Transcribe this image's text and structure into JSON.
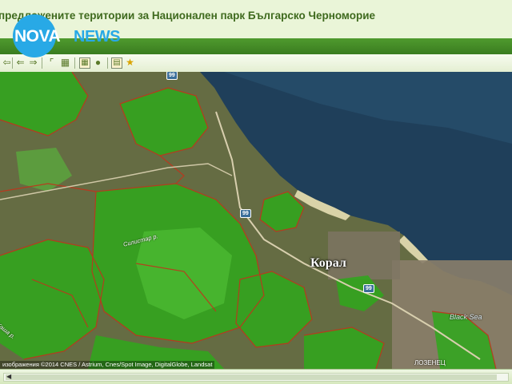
{
  "header": {
    "title": "предложените територии за Национален парк Българско Черноморие",
    "logo_nova": "NOVA",
    "logo_news": "NEWS",
    "brand_blue": "#28a9e6",
    "band_green": "#3a7d20"
  },
  "toolbar": {
    "icons": [
      "arrow-left-icon",
      "arrow-right-icon",
      "select-icon",
      "crop-icon",
      "map-layer-icon",
      "globe-icon",
      "print-icon",
      "star-icon"
    ]
  },
  "map": {
    "place_label": "Корал",
    "sea_label": "Black Sea",
    "town_label": "ЛОЗЕНЕЦ",
    "road_label": "Силистар р.",
    "river_label": "Каша р.",
    "road_shields": [
      "99",
      "99",
      "99"
    ],
    "credit": "изображения ©2014 CNES / Astrium, Cnes/Spot Image, DigitalGlobe, Landsat",
    "park_color": "#2fa81c",
    "boundary_color": "#c0341c",
    "sea_color": "#1f3f5a"
  }
}
